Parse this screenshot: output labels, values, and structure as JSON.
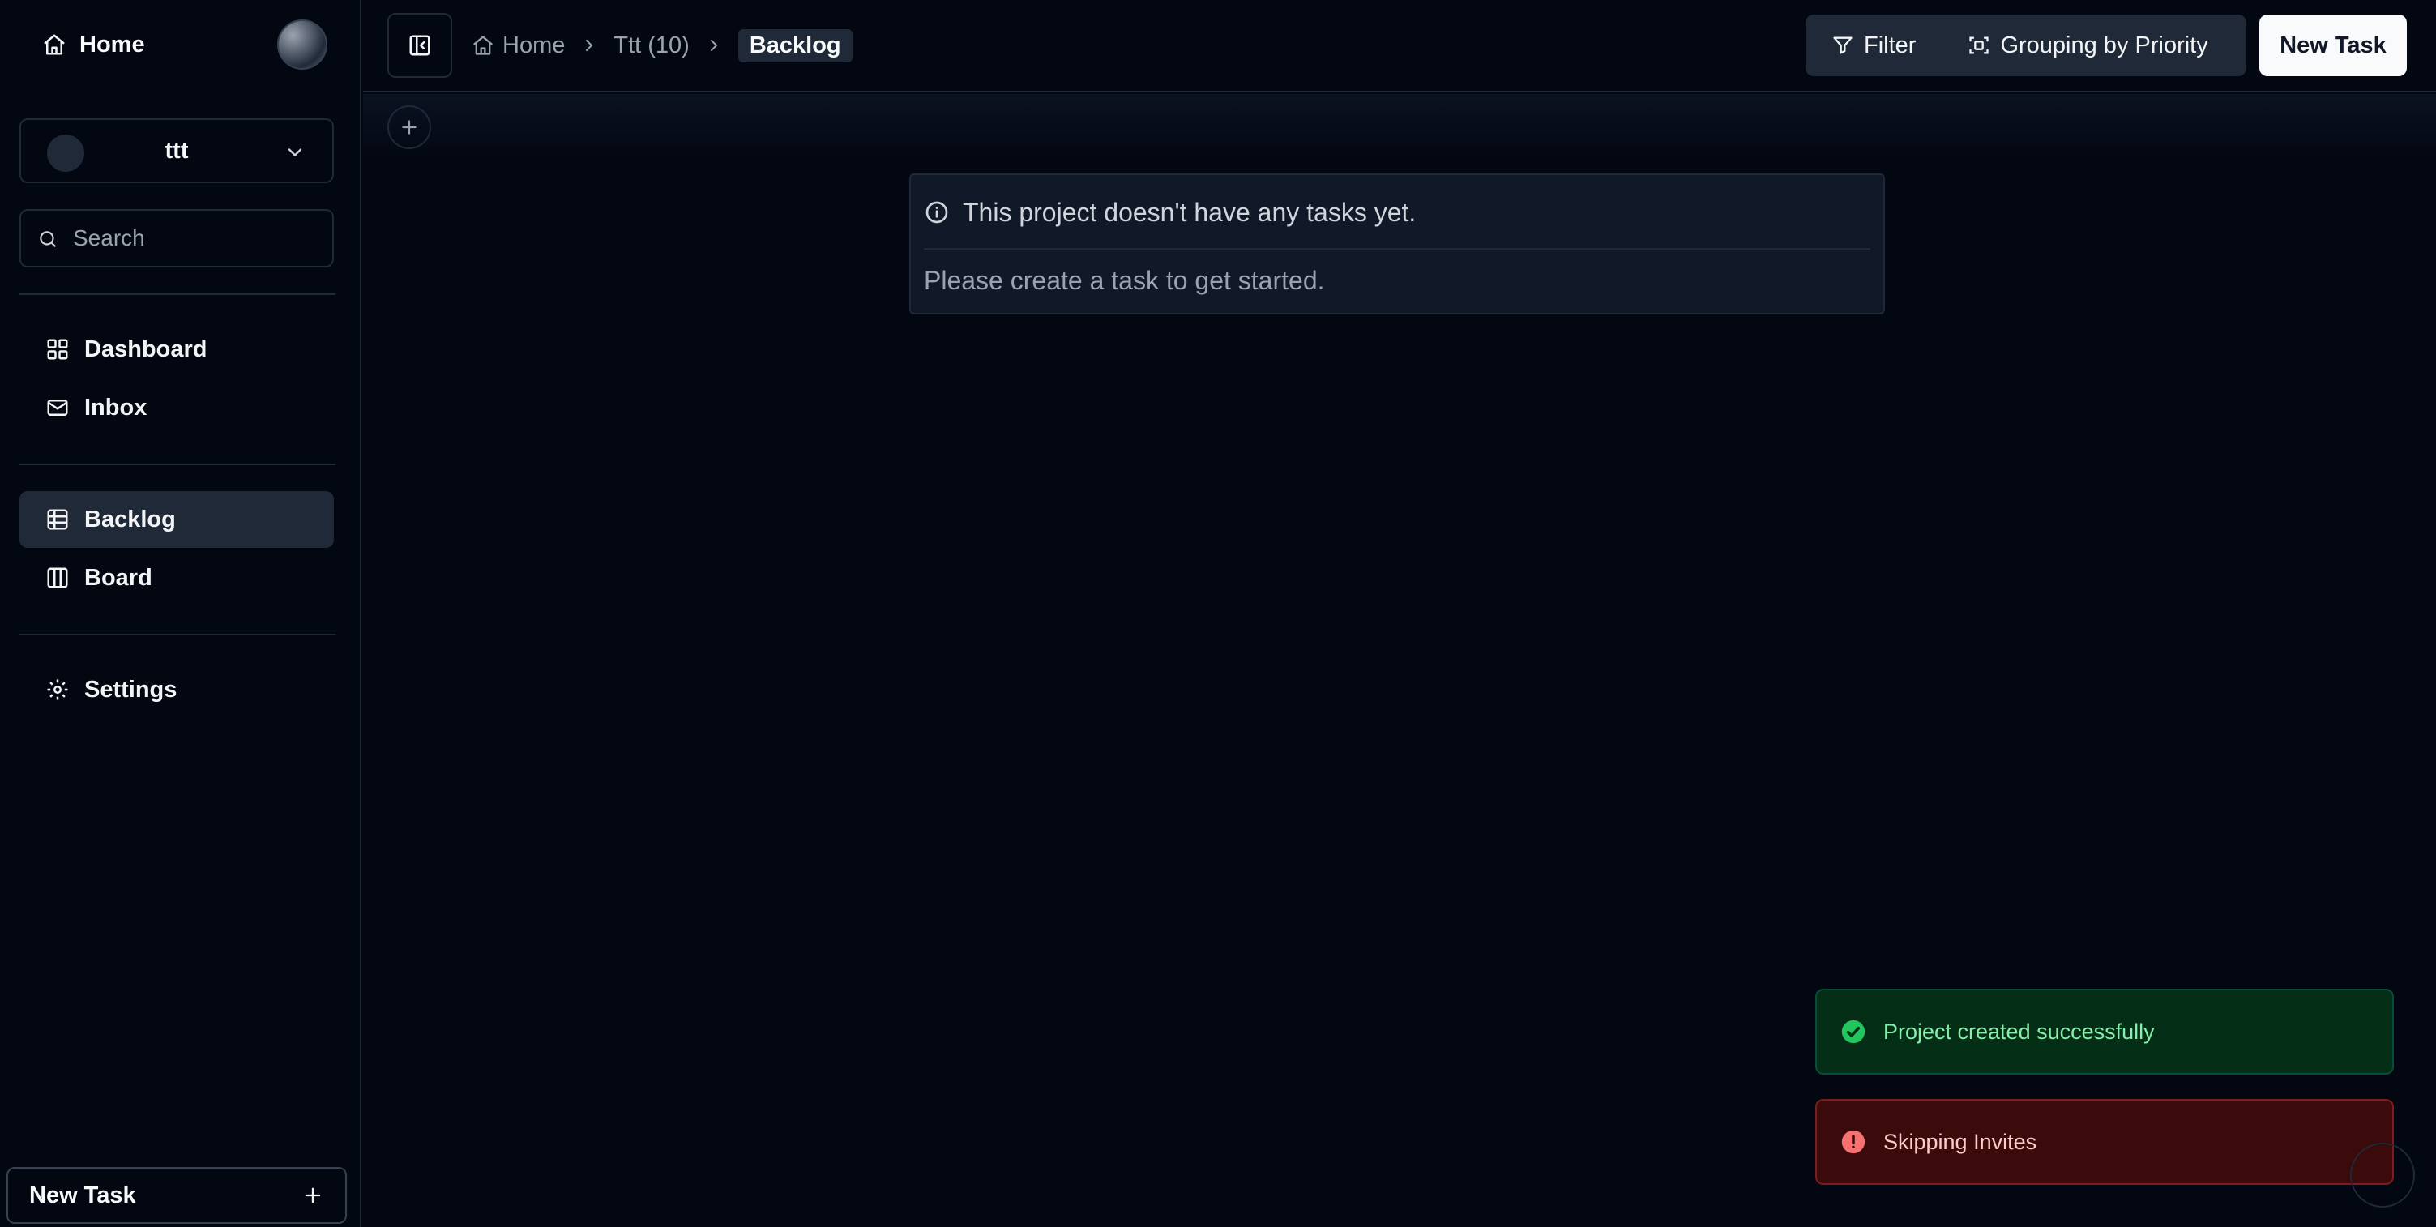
{
  "sidebar": {
    "home_label": "Home",
    "project": {
      "name": "ttt"
    },
    "search": {
      "placeholder": "Search",
      "value": ""
    },
    "items": [
      {
        "label": "Dashboard",
        "icon": "grid-icon"
      },
      {
        "label": "Inbox",
        "icon": "mail-icon"
      },
      {
        "label": "Backlog",
        "icon": "table-icon",
        "active": true
      },
      {
        "label": "Board",
        "icon": "columns-icon"
      },
      {
        "label": "Settings",
        "icon": "gear-icon"
      }
    ],
    "new_task_label": "New Task"
  },
  "header": {
    "breadcrumb": [
      {
        "label": "Home",
        "icon": "home-icon"
      },
      {
        "label": "Ttt (10)"
      },
      {
        "label": "Backlog",
        "current": true
      }
    ],
    "filter_label": "Filter",
    "grouping_label": "Grouping by Priority",
    "new_task_label": "New Task"
  },
  "empty_state": {
    "title": "This project doesn't have any tasks yet.",
    "description": "Please create a task to get started."
  },
  "toasts": [
    {
      "type": "success",
      "message": "Project created successfully",
      "color": "#22c55e"
    },
    {
      "type": "error",
      "message": "Skipping Invites",
      "color": "#f87171"
    }
  ],
  "colors": {
    "background": "#030712",
    "surface": "#111827",
    "border": "#1f2937",
    "accent_button": "#f9fafb"
  }
}
